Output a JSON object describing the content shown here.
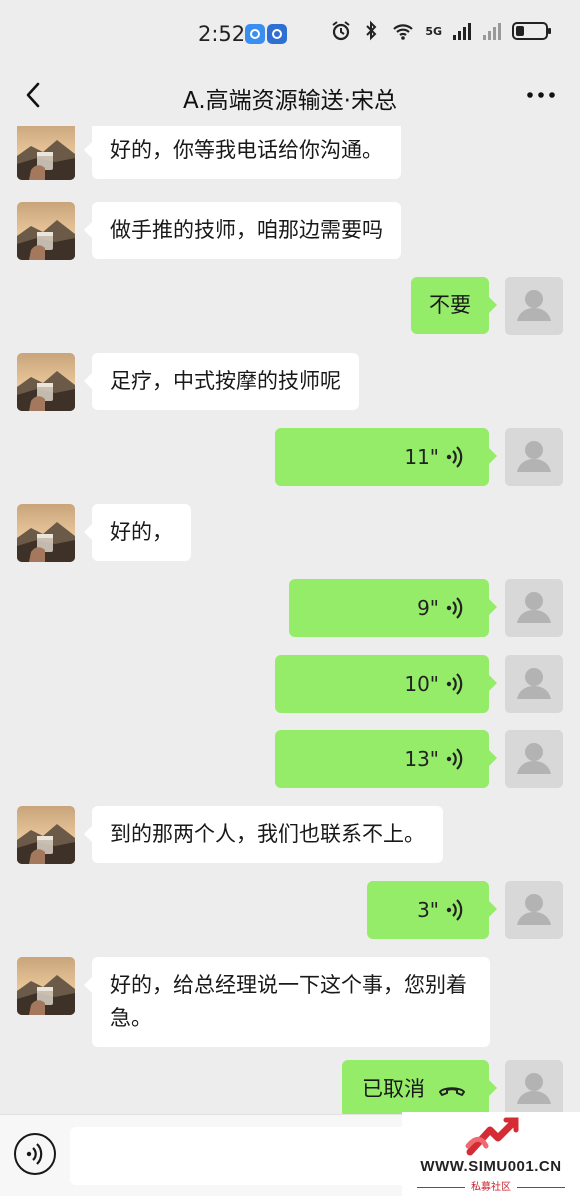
{
  "status_bar": {
    "time": "2:52",
    "network": "5G"
  },
  "nav": {
    "title": "A.高端资源输送·宋总"
  },
  "messages": [
    {
      "side": "in",
      "type": "text",
      "text": "好的，你等我电话给你沟通。"
    },
    {
      "side": "in",
      "type": "text",
      "text": "做手推的技师，咱那边需要吗"
    },
    {
      "side": "out",
      "type": "text",
      "text": "不要"
    },
    {
      "side": "in",
      "type": "text",
      "text": "足疗，中式按摩的技师呢"
    },
    {
      "side": "out",
      "type": "voice",
      "duration": "11\""
    },
    {
      "side": "in",
      "type": "text",
      "text": "好的，"
    },
    {
      "side": "out",
      "type": "voice",
      "duration": "9\""
    },
    {
      "side": "out",
      "type": "voice",
      "duration": "10\""
    },
    {
      "side": "out",
      "type": "voice",
      "duration": "13\""
    },
    {
      "side": "in",
      "type": "text",
      "text": "到的那两个人，我们也联系不上。"
    },
    {
      "side": "out",
      "type": "voice",
      "duration": "3\""
    },
    {
      "side": "in",
      "type": "text",
      "text": "好的，给总经理说一下这个事，您别着急。"
    },
    {
      "side": "out",
      "type": "call",
      "text": "已取消"
    }
  ],
  "watermark": {
    "site": "WWW.SIMU001.CN",
    "tagline": "私募社区"
  },
  "colors": {
    "background": "#ededed",
    "outgoing_bubble": "#95ec69",
    "incoming_bubble": "#ffffff"
  }
}
